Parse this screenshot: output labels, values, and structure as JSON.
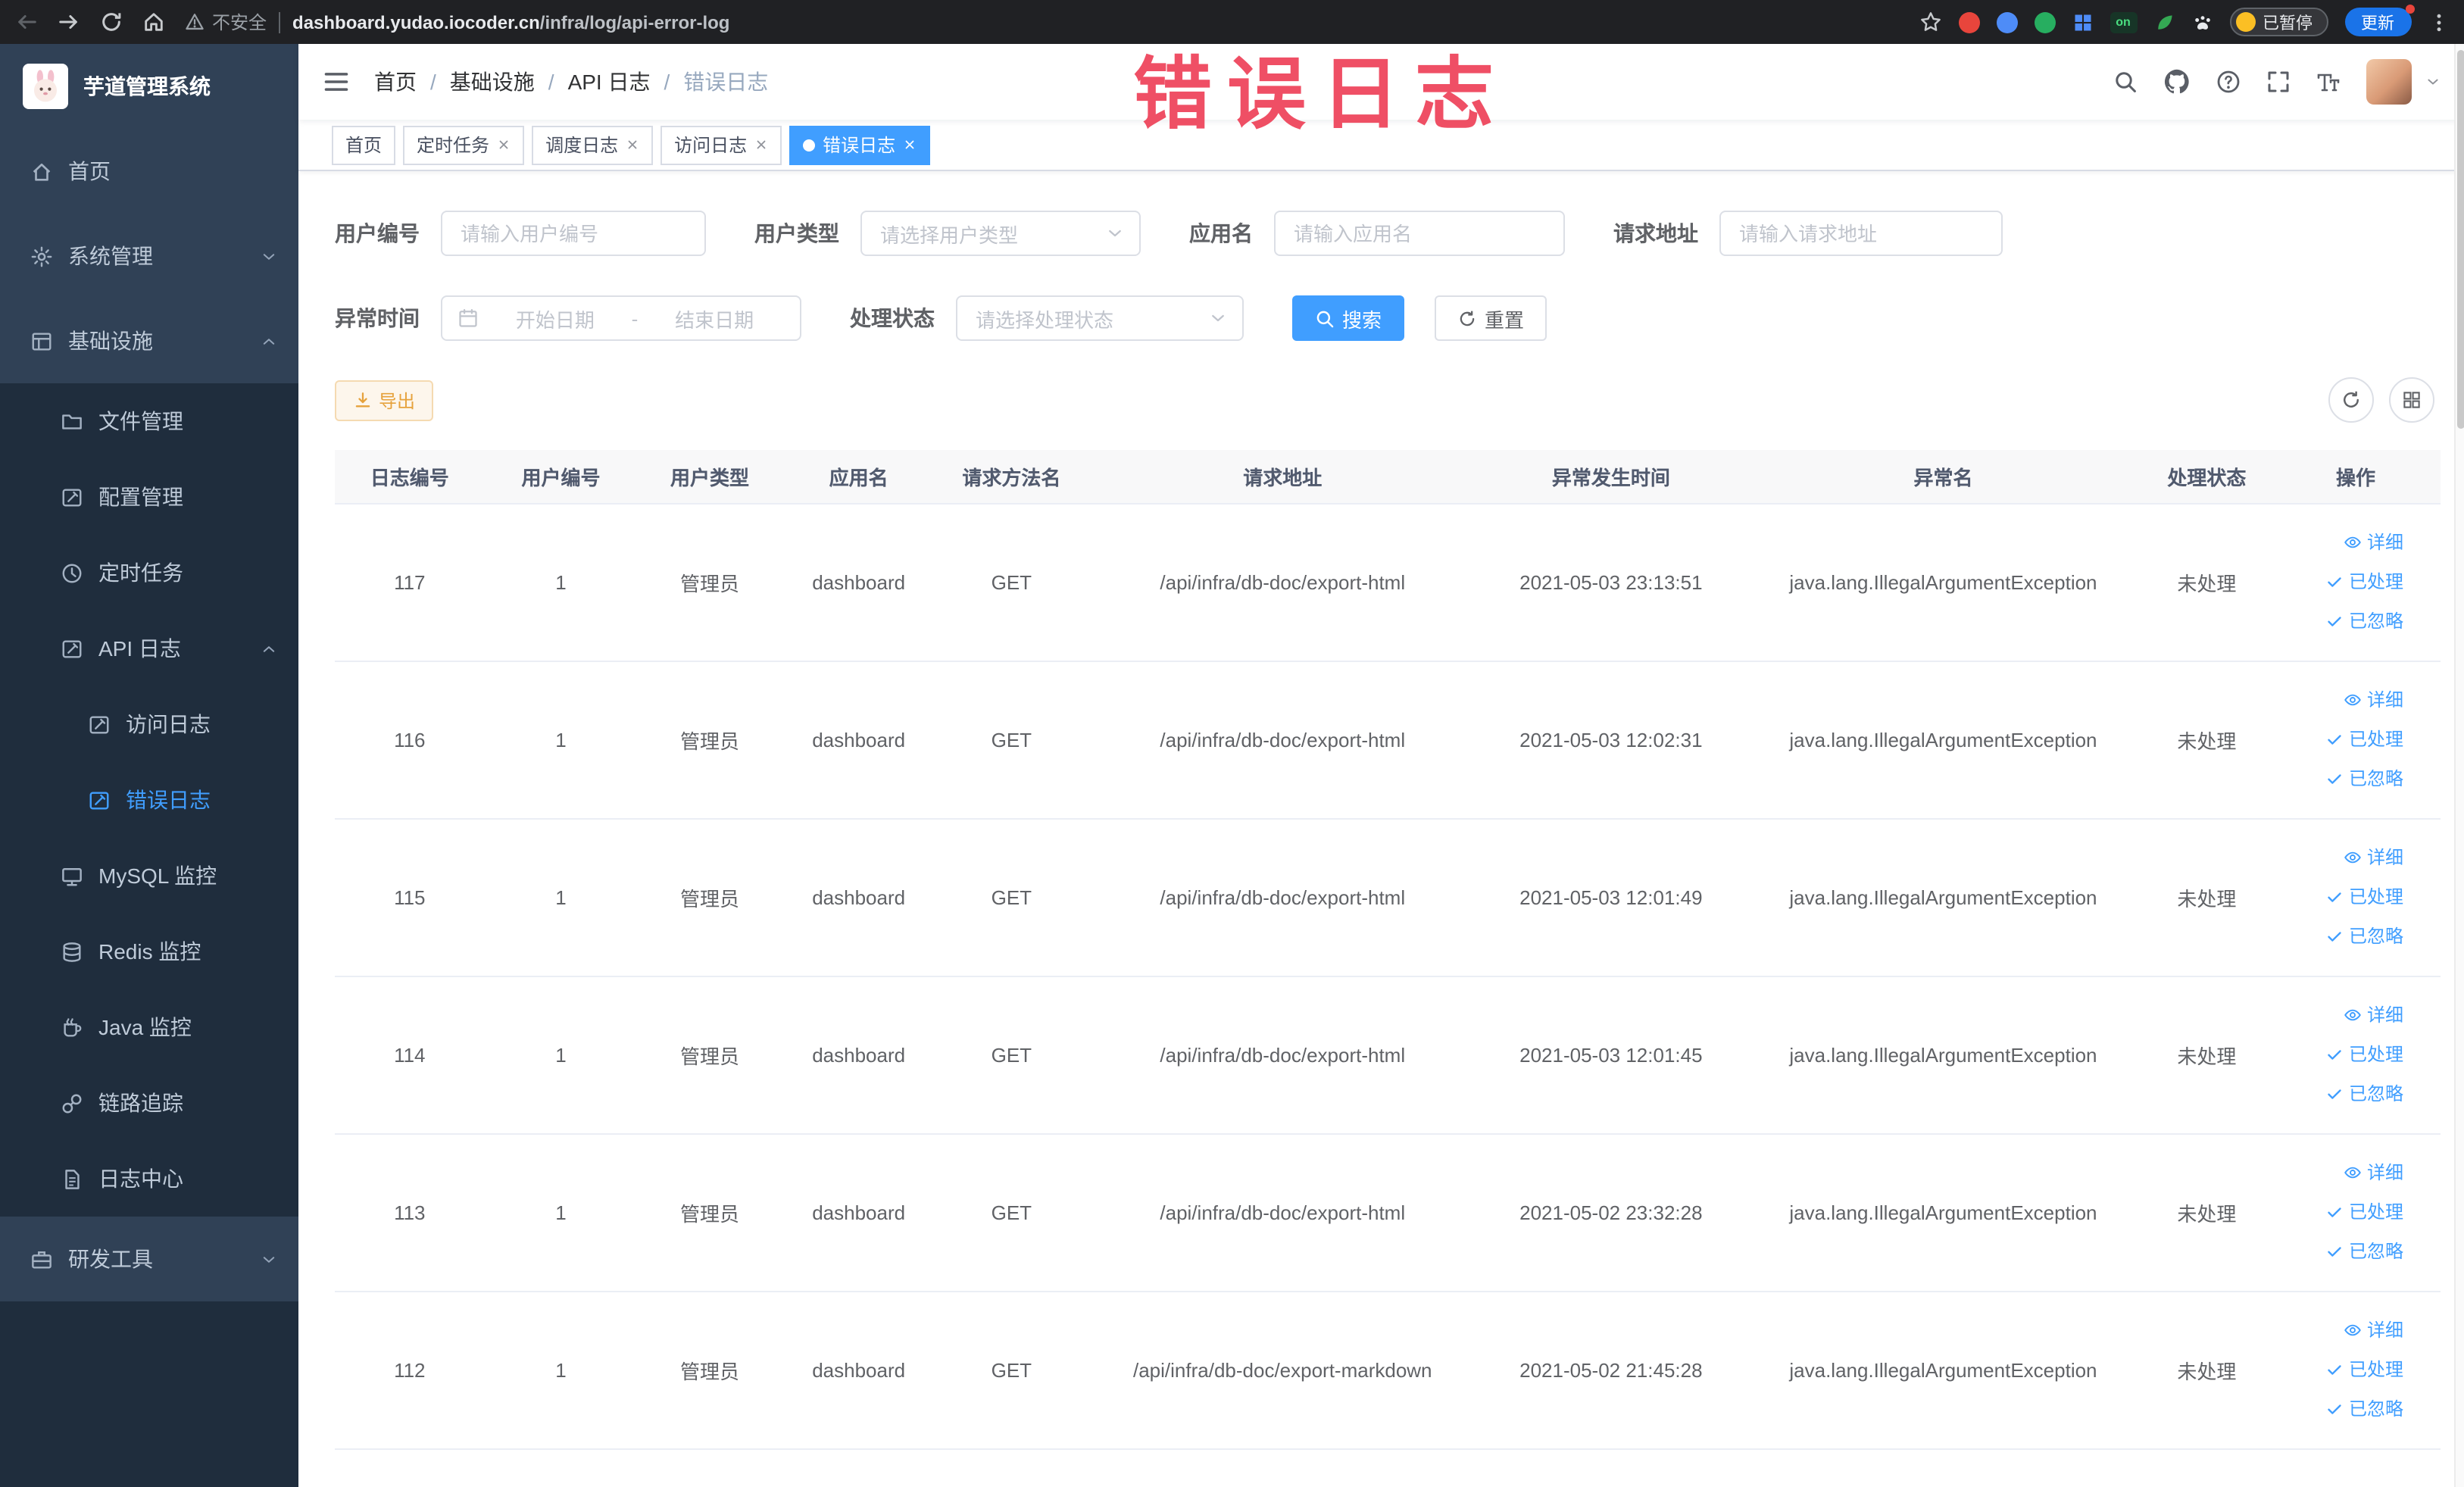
{
  "watermark": "错误日志",
  "browser": {
    "security": "不安全",
    "url_domain": "dashboard.yudao.iocoder.cn",
    "url_path": "/infra/log/api-error-log",
    "on_badge": "on",
    "paused": "已暂停",
    "update": "更新"
  },
  "sidebar": {
    "title": "芋道管理系统",
    "items": [
      {
        "label": "首页"
      },
      {
        "label": "系统管理"
      },
      {
        "label": "基础设施"
      },
      {
        "label": "文件管理"
      },
      {
        "label": "配置管理"
      },
      {
        "label": "定时任务"
      },
      {
        "label": "API 日志"
      },
      {
        "label": "访问日志"
      },
      {
        "label": "错误日志"
      },
      {
        "label": "MySQL 监控"
      },
      {
        "label": "Redis 监控"
      },
      {
        "label": "Java 监控"
      },
      {
        "label": "链路追踪"
      },
      {
        "label": "日志中心"
      },
      {
        "label": "研发工具"
      }
    ]
  },
  "breadcrumb": {
    "separator": "/",
    "items": [
      "首页",
      "基础设施",
      "API 日志",
      "错误日志"
    ]
  },
  "tags": [
    {
      "label": "首页"
    },
    {
      "label": "定时任务"
    },
    {
      "label": "调度日志"
    },
    {
      "label": "访问日志"
    },
    {
      "label": "错误日志"
    }
  ],
  "filters": {
    "user_id_label": "用户编号",
    "user_id_placeholder": "请输入用户编号",
    "user_type_label": "用户类型",
    "user_type_placeholder": "请选择用户类型",
    "app_name_label": "应用名",
    "app_name_placeholder": "请输入应用名",
    "request_url_label": "请求地址",
    "request_url_placeholder": "请输入请求地址",
    "time_label": "异常时间",
    "time_start_placeholder": "开始日期",
    "time_separator": "-",
    "time_end_placeholder": "结束日期",
    "status_label": "处理状态",
    "status_placeholder": "请选择处理状态",
    "search": "搜索",
    "reset": "重置"
  },
  "toolbar": {
    "export": "导出"
  },
  "table": {
    "columns": [
      "日志编号",
      "用户编号",
      "用户类型",
      "应用名",
      "请求方法名",
      "请求地址",
      "异常发生时间",
      "异常名",
      "处理状态",
      "操作"
    ],
    "actions": {
      "detail": "详细",
      "process": "已处理",
      "ignore": "已忽略"
    },
    "rows": [
      {
        "id": "117",
        "user": "1",
        "type": "管理员",
        "app": "dashboard",
        "method": "GET",
        "url": "/api/infra/db-doc/export-html",
        "time": "2021-05-03 23:13:51",
        "exception": "java.lang.IllegalArgumentException",
        "status": "未处理"
      },
      {
        "id": "116",
        "user": "1",
        "type": "管理员",
        "app": "dashboard",
        "method": "GET",
        "url": "/api/infra/db-doc/export-html",
        "time": "2021-05-03 12:02:31",
        "exception": "java.lang.IllegalArgumentException",
        "status": "未处理"
      },
      {
        "id": "115",
        "user": "1",
        "type": "管理员",
        "app": "dashboard",
        "method": "GET",
        "url": "/api/infra/db-doc/export-html",
        "time": "2021-05-03 12:01:49",
        "exception": "java.lang.IllegalArgumentException",
        "status": "未处理"
      },
      {
        "id": "114",
        "user": "1",
        "type": "管理员",
        "app": "dashboard",
        "method": "GET",
        "url": "/api/infra/db-doc/export-html",
        "time": "2021-05-03 12:01:45",
        "exception": "java.lang.IllegalArgumentException",
        "status": "未处理"
      },
      {
        "id": "113",
        "user": "1",
        "type": "管理员",
        "app": "dashboard",
        "method": "GET",
        "url": "/api/infra/db-doc/export-html",
        "time": "2021-05-02 23:32:28",
        "exception": "java.lang.IllegalArgumentException",
        "status": "未处理"
      },
      {
        "id": "112",
        "user": "1",
        "type": "管理员",
        "app": "dashboard",
        "method": "GET",
        "url": "/api/infra/db-doc/export-markdown",
        "time": "2021-05-02 21:45:28",
        "exception": "java.lang.IllegalArgumentException",
        "status": "未处理"
      }
    ]
  }
}
